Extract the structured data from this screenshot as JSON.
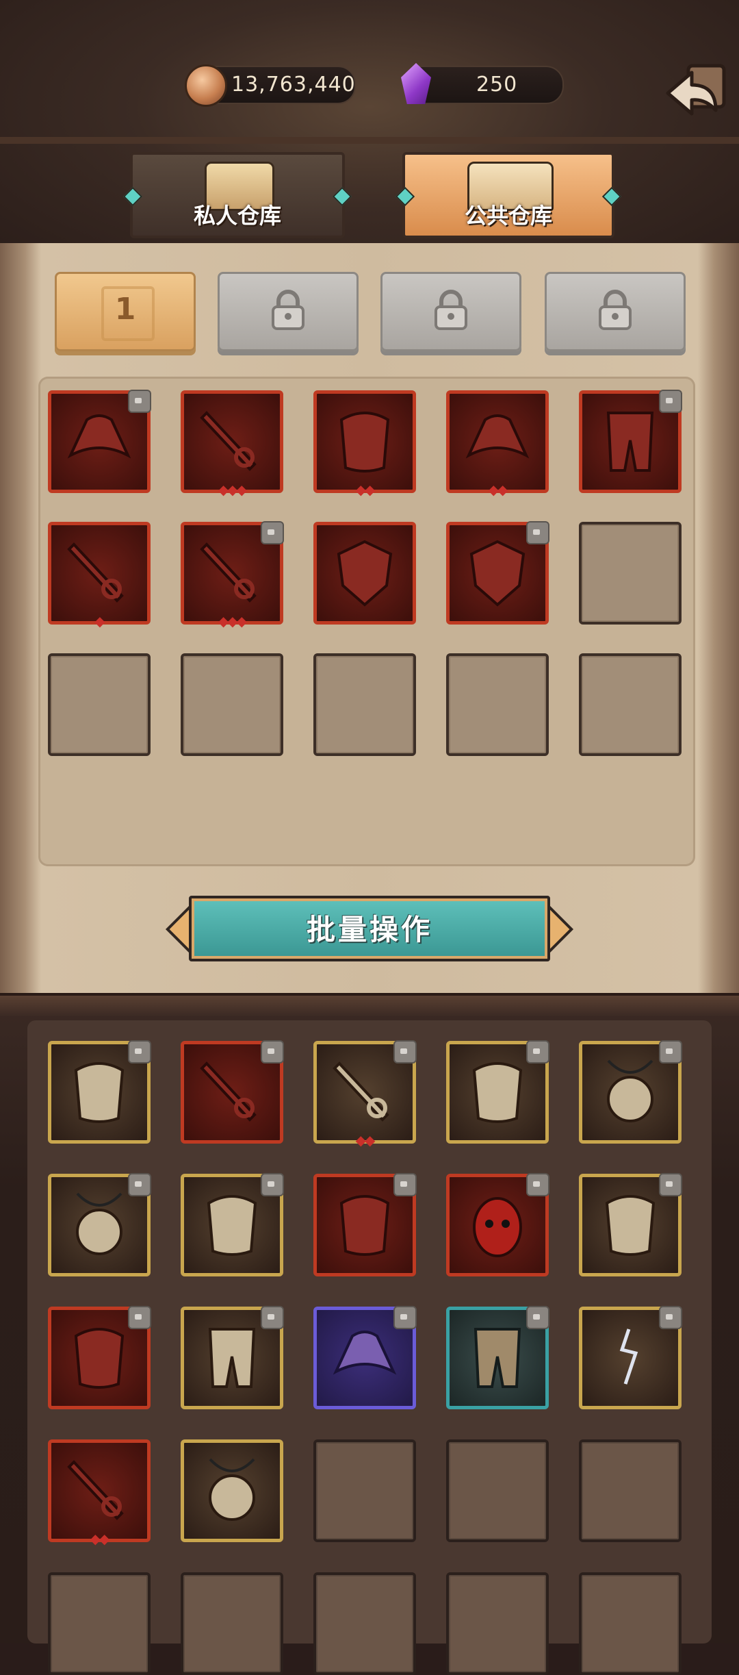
{
  "currencies": {
    "gold": {
      "icon": "gold-coin-icon",
      "value": "13,763,440"
    },
    "gems": {
      "icon": "purple-gem-icon",
      "value": "250"
    }
  },
  "warehouse_tabs": [
    {
      "label": "私人仓库",
      "active": false
    },
    {
      "label": "公共仓库",
      "active": true
    }
  ],
  "page_tabs": [
    {
      "label": "1",
      "state": "active"
    },
    {
      "label": "",
      "state": "locked"
    },
    {
      "label": "",
      "state": "locked"
    },
    {
      "label": "",
      "state": "locked"
    }
  ],
  "batch_button": {
    "label": "批量操作"
  },
  "public_storage": {
    "slots": [
      {
        "type": "item",
        "rarity": "red",
        "icon": "hat-icon",
        "locked": true,
        "stars": 0
      },
      {
        "type": "item",
        "rarity": "red",
        "icon": "sword-icon",
        "locked": false,
        "stars": 3
      },
      {
        "type": "item",
        "rarity": "red",
        "icon": "armor-icon",
        "locked": false,
        "stars": 2
      },
      {
        "type": "item",
        "rarity": "red",
        "icon": "hat-icon",
        "locked": false,
        "stars": 2
      },
      {
        "type": "item",
        "rarity": "red",
        "icon": "boots-icon",
        "locked": true,
        "stars": 0
      },
      {
        "type": "item",
        "rarity": "red",
        "icon": "sword-icon",
        "locked": false,
        "stars": 1
      },
      {
        "type": "item",
        "rarity": "red",
        "icon": "dagger-icon",
        "locked": true,
        "stars": 3
      },
      {
        "type": "item",
        "rarity": "red",
        "icon": "shield-icon",
        "locked": false,
        "stars": 0
      },
      {
        "type": "item",
        "rarity": "red",
        "icon": "round-shield-icon",
        "locked": true,
        "stars": 0
      },
      {
        "type": "empty"
      },
      {
        "type": "empty"
      },
      {
        "type": "empty"
      },
      {
        "type": "empty"
      },
      {
        "type": "empty"
      },
      {
        "type": "empty"
      }
    ]
  },
  "inventory": {
    "slots": [
      {
        "type": "item",
        "rarity": "gold",
        "icon": "armor-icon",
        "locked": true,
        "stars": 0
      },
      {
        "type": "item",
        "rarity": "red",
        "icon": "scimitar-icon",
        "locked": true,
        "stars": 0
      },
      {
        "type": "item",
        "rarity": "gold",
        "icon": "staff-icon",
        "locked": true,
        "stars": 2
      },
      {
        "type": "item",
        "rarity": "gold",
        "icon": "feather-cloak-icon",
        "locked": true,
        "stars": 0
      },
      {
        "type": "item",
        "rarity": "gold",
        "icon": "lion-amulet-icon",
        "locked": true,
        "stars": 0
      },
      {
        "type": "item",
        "rarity": "gold",
        "icon": "gem-amulet-icon",
        "locked": true,
        "stars": 0
      },
      {
        "type": "item",
        "rarity": "gold",
        "icon": "feather-cloak-icon",
        "locked": true,
        "stars": 0
      },
      {
        "type": "item",
        "rarity": "red",
        "icon": "claw-icon",
        "locked": true,
        "stars": 0
      },
      {
        "type": "item",
        "rarity": "red",
        "icon": "demon-mask-icon",
        "locked": true,
        "stars": 0
      },
      {
        "type": "item",
        "rarity": "gold",
        "icon": "cape-icon",
        "locked": true,
        "stars": 0
      },
      {
        "type": "item",
        "rarity": "red",
        "icon": "armor-icon",
        "locked": true,
        "stars": 0
      },
      {
        "type": "item",
        "rarity": "gold",
        "icon": "winged-boots-icon",
        "locked": true,
        "stars": 0
      },
      {
        "type": "item",
        "rarity": "purple",
        "icon": "wizard-hat-icon",
        "locked": true,
        "stars": 0
      },
      {
        "type": "item",
        "rarity": "teal",
        "icon": "pants-icon",
        "locked": true,
        "stars": 0
      },
      {
        "type": "item",
        "rarity": "gold",
        "icon": "lightning-ring-icon",
        "locked": true,
        "stars": 0
      },
      {
        "type": "item",
        "rarity": "red",
        "icon": "greatsword-icon",
        "locked": false,
        "stars": 2
      },
      {
        "type": "item",
        "rarity": "gold",
        "icon": "lion-amulet-icon",
        "locked": false,
        "stars": 0
      },
      {
        "type": "empty"
      },
      {
        "type": "empty"
      },
      {
        "type": "empty"
      },
      {
        "type": "empty"
      },
      {
        "type": "empty"
      },
      {
        "type": "empty"
      },
      {
        "type": "empty"
      },
      {
        "type": "empty"
      }
    ]
  },
  "colors": {
    "red_frame": "#bf3a22",
    "gold_frame": "#c9a64e",
    "purple_frame": "#6b5cd8",
    "teal_frame": "#3aa1a4",
    "button_teal": "#4aa9a4"
  }
}
